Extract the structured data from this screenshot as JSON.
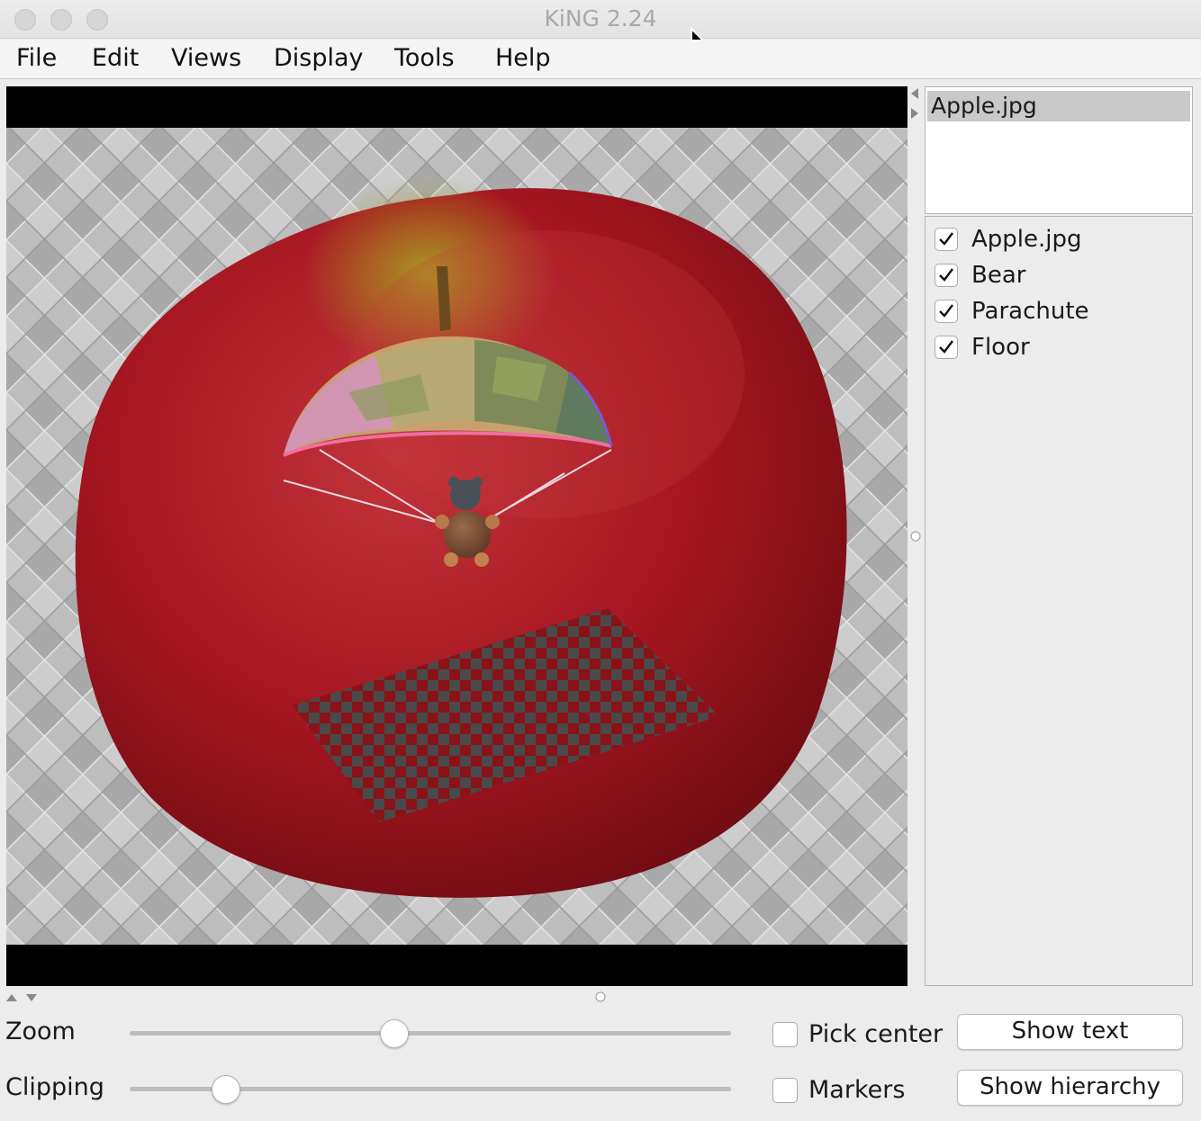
{
  "window": {
    "title": "KiNG 2.24"
  },
  "menu": [
    "File",
    "Edit",
    "Views",
    "Display",
    "Tools",
    "Help"
  ],
  "kinemages": {
    "selected": "Apple.jpg"
  },
  "groups": [
    {
      "label": "Apple.jpg",
      "checked": true
    },
    {
      "label": "Bear",
      "checked": true
    },
    {
      "label": "Parachute",
      "checked": true
    },
    {
      "label": "Floor",
      "checked": true
    }
  ],
  "controls": {
    "zoom_label": "Zoom",
    "zoom_value": 0.44,
    "clipping_label": "Clipping",
    "clipping_value": 0.16,
    "pick_center_label": "Pick center",
    "pick_center_checked": false,
    "markers_label": "Markers",
    "markers_checked": false,
    "show_text_label": "Show text",
    "show_hierarchy_label": "Show hierarchy"
  },
  "colors": {
    "apple": "#a8141c",
    "viewport_bg": "#000000",
    "selection": "#c9c9c9"
  }
}
